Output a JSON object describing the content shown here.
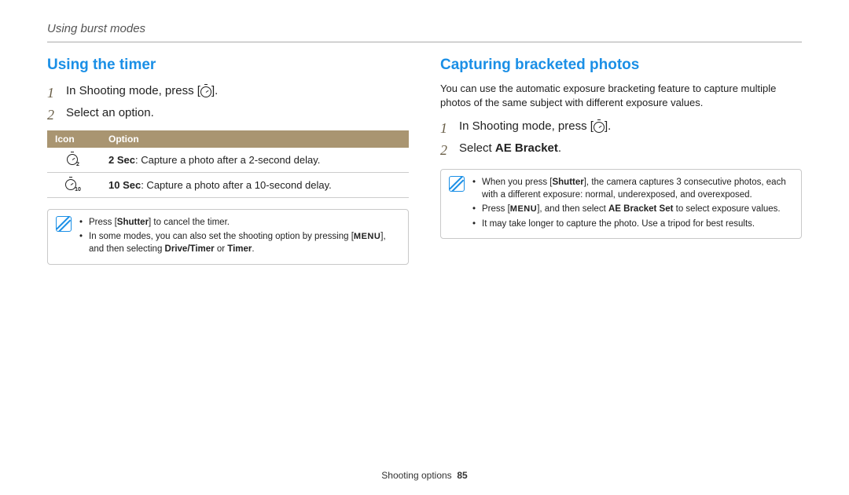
{
  "breadcrumb": "Using burst modes",
  "left": {
    "heading": "Using the timer",
    "step1_pre": "In Shooting mode, press [",
    "step1_post": "].",
    "step2": "Select an option.",
    "table": {
      "h_icon": "Icon",
      "h_option": "Option",
      "row1_bold": "2 Sec",
      "row1_rest": ": Capture a photo after a 2-second delay.",
      "row1_sub": "2",
      "row2_bold": "10 Sec",
      "row2_rest": ": Capture a photo after a 10-second delay.",
      "row2_sub": "10"
    },
    "notes": {
      "n1_a": "Press [",
      "n1_b": "Shutter",
      "n1_c": "] to cancel the timer.",
      "n2_a": "In some modes, you can also set the shooting option by pressing [",
      "n2_menu": "MENU",
      "n2_b": "], and then selecting ",
      "n2_bold1": "Drive/Timer",
      "n2_or": " or ",
      "n2_bold2": "Timer",
      "n2_end": "."
    }
  },
  "right": {
    "heading": "Capturing bracketed photos",
    "intro": "You can use the automatic exposure bracketing feature to capture multiple photos of the same subject with different exposure values.",
    "step1_pre": "In Shooting mode, press [",
    "step1_post": "].",
    "step2_a": "Select ",
    "step2_bold": "AE Bracket",
    "step2_b": ".",
    "notes": {
      "n1_a": "When you press [",
      "n1_b": "Shutter",
      "n1_c": "], the camera captures 3 consecutive photos, each with a different exposure: normal, underexposed, and overexposed.",
      "n2_a": "Press [",
      "n2_menu": "MENU",
      "n2_b": "], and then select ",
      "n2_bold": "AE Bracket Set",
      "n2_c": " to select exposure values.",
      "n3": "It may take longer to capture the photo. Use a tripod for best results."
    }
  },
  "footer_a": "Shooting options",
  "footer_b": "85"
}
